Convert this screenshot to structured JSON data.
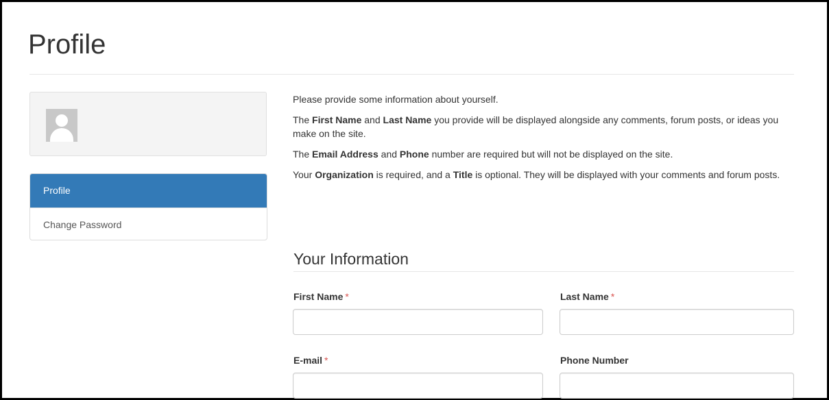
{
  "page": {
    "title": "Profile"
  },
  "sidebar": {
    "nav": [
      {
        "label": "Profile",
        "active": true
      },
      {
        "label": "Change Password",
        "active": false
      }
    ]
  },
  "intro": {
    "p1": "Please provide some information about yourself.",
    "p2": {
      "a": "The ",
      "b": "First Name",
      "c": " and ",
      "d": "Last Name",
      "e": " you provide will be displayed alongside any comments, forum posts, or ideas you make on the site."
    },
    "p3": {
      "a": "The ",
      "b": "Email Address",
      "c": " and ",
      "d": "Phone",
      "e": " number are required but will not be displayed on the site."
    },
    "p4": {
      "a": "Your ",
      "b": "Organization",
      "c": " is required, and a ",
      "d": "Title",
      "e": " is optional. They will be displayed with your comments and forum posts."
    }
  },
  "form": {
    "section_title": "Your Information",
    "required_marker": "*",
    "fields": {
      "first_name": {
        "label": "First Name",
        "value": "",
        "required": true
      },
      "last_name": {
        "label": "Last Name",
        "value": "",
        "required": true
      },
      "email": {
        "label": "E-mail",
        "value": "",
        "required": true
      },
      "phone": {
        "label": "Phone Number",
        "value": "",
        "required": false
      }
    }
  },
  "colors": {
    "accent": "#337ab7",
    "required": "#d9534f",
    "text": "#333333"
  }
}
